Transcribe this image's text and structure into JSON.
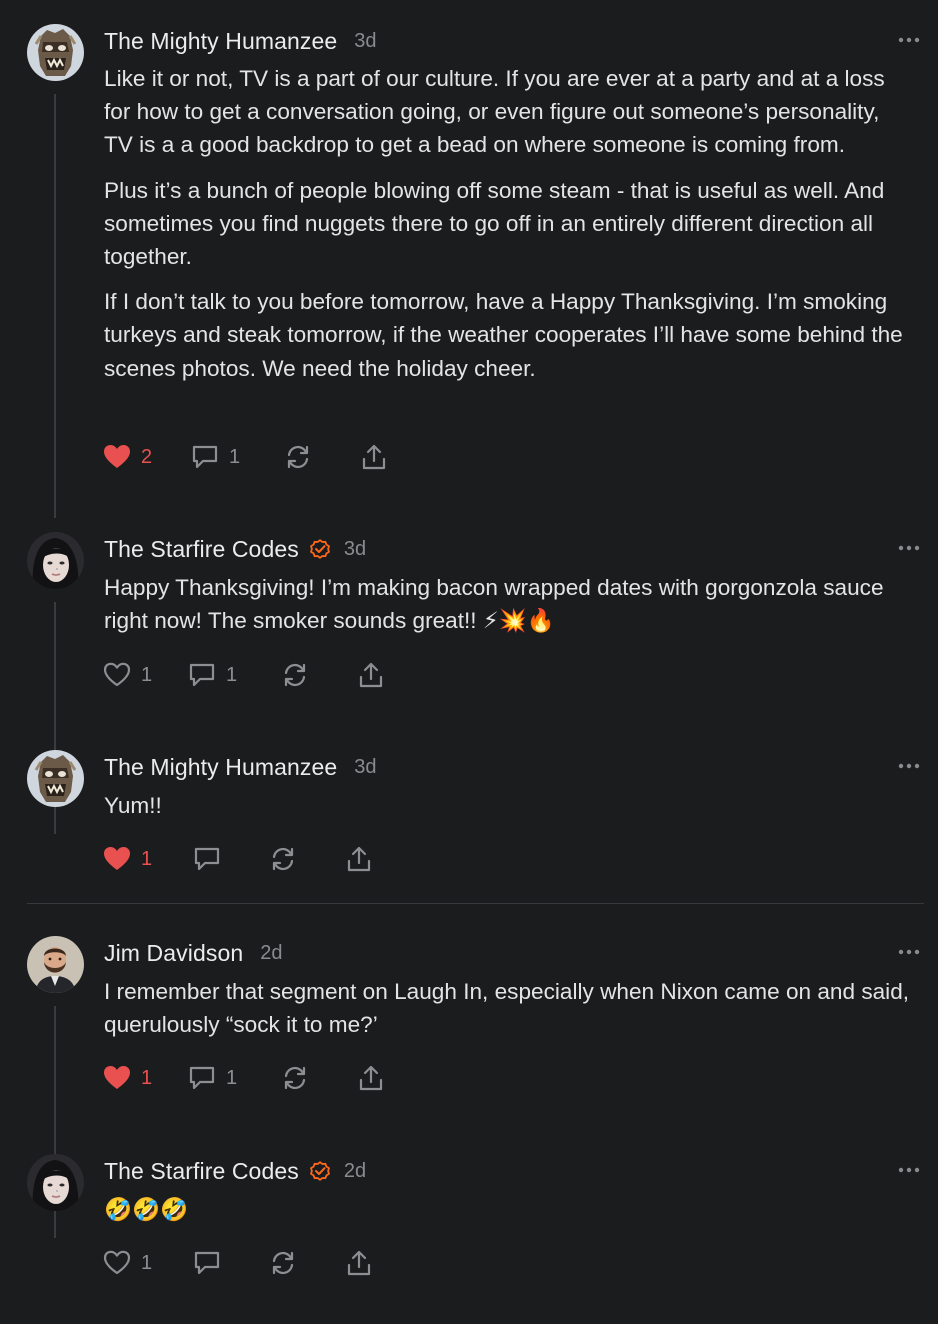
{
  "comments": [
    {
      "author": "The Mighty Humanzee",
      "time": "3d",
      "verified": false,
      "avatar": "humanzee-mask-avatar",
      "paragraphs": [
        "Like it or not, TV is a part of our culture. If you are ever at a party and at a loss for how to get a conversation going, or even figure out someone’s personality, TV is a a good backdrop to get a bead on where someone is coming from.",
        "Plus it’s a bunch of people blowing off some steam - that is useful as well. And sometimes you find nuggets there to go off in an entirely different direction all together.",
        "If I don’t talk to you before tomorrow, have a Happy Thanksgiving. I’m smoking turkeys and steak tomorrow, if the weather cooperates I’ll have some behind the scenes photos. We need the holiday cheer."
      ],
      "likes": "2",
      "liked": true,
      "replies": "1"
    },
    {
      "author": "The Starfire Codes",
      "time": "3d",
      "verified": true,
      "avatar": "starfire-portrait-avatar",
      "paragraphs": [
        "Happy Thanksgiving! I’m making bacon wrapped dates with gorgonzola sauce right now! The smoker sounds great!! ⚡💥🔥"
      ],
      "likes": "1",
      "liked": false,
      "replies": "1"
    },
    {
      "author": "The Mighty Humanzee",
      "time": "3d",
      "verified": false,
      "avatar": "humanzee-mask-avatar",
      "paragraphs": [
        "Yum!!"
      ],
      "likes": "1",
      "liked": true,
      "replies": ""
    },
    {
      "author": "Jim Davidson",
      "time": "2d",
      "verified": false,
      "avatar": "bearded-man-avatar",
      "paragraphs": [
        "I remember that segment on Laugh In, especially when Nixon came on and said, querulously “sock it to me?’"
      ],
      "likes": "1",
      "liked": true,
      "replies": "1"
    },
    {
      "author": "The Starfire Codes",
      "time": "2d",
      "verified": true,
      "avatar": "starfire-portrait-avatar",
      "paragraphs": [
        "🤣🤣🤣"
      ],
      "likes": "1",
      "liked": false,
      "replies": ""
    }
  ],
  "colors": {
    "background": "#1b1c1e",
    "like_red": "#e8514f",
    "verified_orange": "#ff6719",
    "muted": "#8a8b8e"
  }
}
